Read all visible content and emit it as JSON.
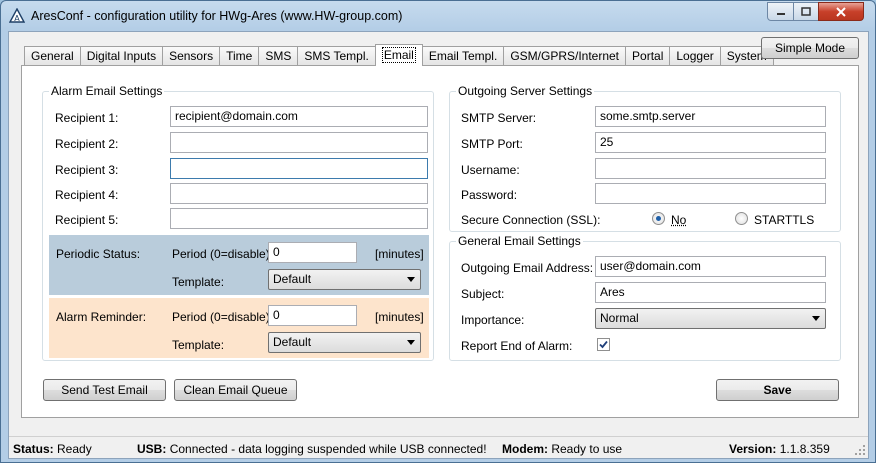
{
  "window": {
    "title": "AresConf - configuration utility for HWg-Ares (www.HW-group.com)"
  },
  "tabs": [
    "General",
    "Digital Inputs",
    "Sensors",
    "Time",
    "SMS",
    "SMS Templ.",
    "Email",
    "Email Templ.",
    "GSM/GPRS/Internet",
    "Portal",
    "Logger",
    "System"
  ],
  "active_tab": "Email",
  "simple_mode_label": "Simple Mode",
  "alarm": {
    "title": "Alarm Email Settings",
    "recipients": [
      {
        "label": "Recipient 1:",
        "value": "recipient@domain.com"
      },
      {
        "label": "Recipient 2:",
        "value": ""
      },
      {
        "label": "Recipient 3:",
        "value": ""
      },
      {
        "label": "Recipient 4:",
        "value": ""
      },
      {
        "label": "Recipient 5:",
        "value": ""
      }
    ],
    "periodic": {
      "label": "Periodic Status:",
      "period_label": "Period (0=disable):",
      "period_value": "0",
      "unit": "[minutes]",
      "template_label": "Template:",
      "template_value": "Default",
      "color": "#b9ccdb"
    },
    "reminder": {
      "label": "Alarm Reminder:",
      "period_label": "Period (0=disable):",
      "period_value": "0",
      "unit": "[minutes]",
      "template_label": "Template:",
      "template_value": "Default",
      "color": "#fde4cc"
    }
  },
  "outgoing": {
    "title": "Outgoing Server Settings",
    "smtp_server_label": "SMTP Server:",
    "smtp_server": "some.smtp.server",
    "smtp_port_label": "SMTP Port:",
    "smtp_port": "25",
    "username_label": "Username:",
    "username": "",
    "password_label": "Password:",
    "password": "",
    "ssl_label": "Secure Connection (SSL):",
    "ssl_no": "No",
    "ssl_starttls": "STARTTLS",
    "ssl_selected": "No"
  },
  "general": {
    "title": "General Email Settings",
    "address_label": "Outgoing Email Address:",
    "address": "user@domain.com",
    "subject_label": "Subject:",
    "subject": "Ares",
    "importance_label": "Importance:",
    "importance": "Normal",
    "report_label": "Report End of Alarm:",
    "report_checked": true
  },
  "buttons": {
    "send_test": "Send Test Email",
    "clean_queue": "Clean Email Queue",
    "save": "Save"
  },
  "status": {
    "status_label": "Status:",
    "status_value": "Ready",
    "usb_label": "USB:",
    "usb_value": "Connected - data logging suspended while USB connected!",
    "modem_label": "Modem:",
    "modem_value": "Ready to use",
    "version_label": "Version:",
    "version_value": "1.1.8.359"
  }
}
